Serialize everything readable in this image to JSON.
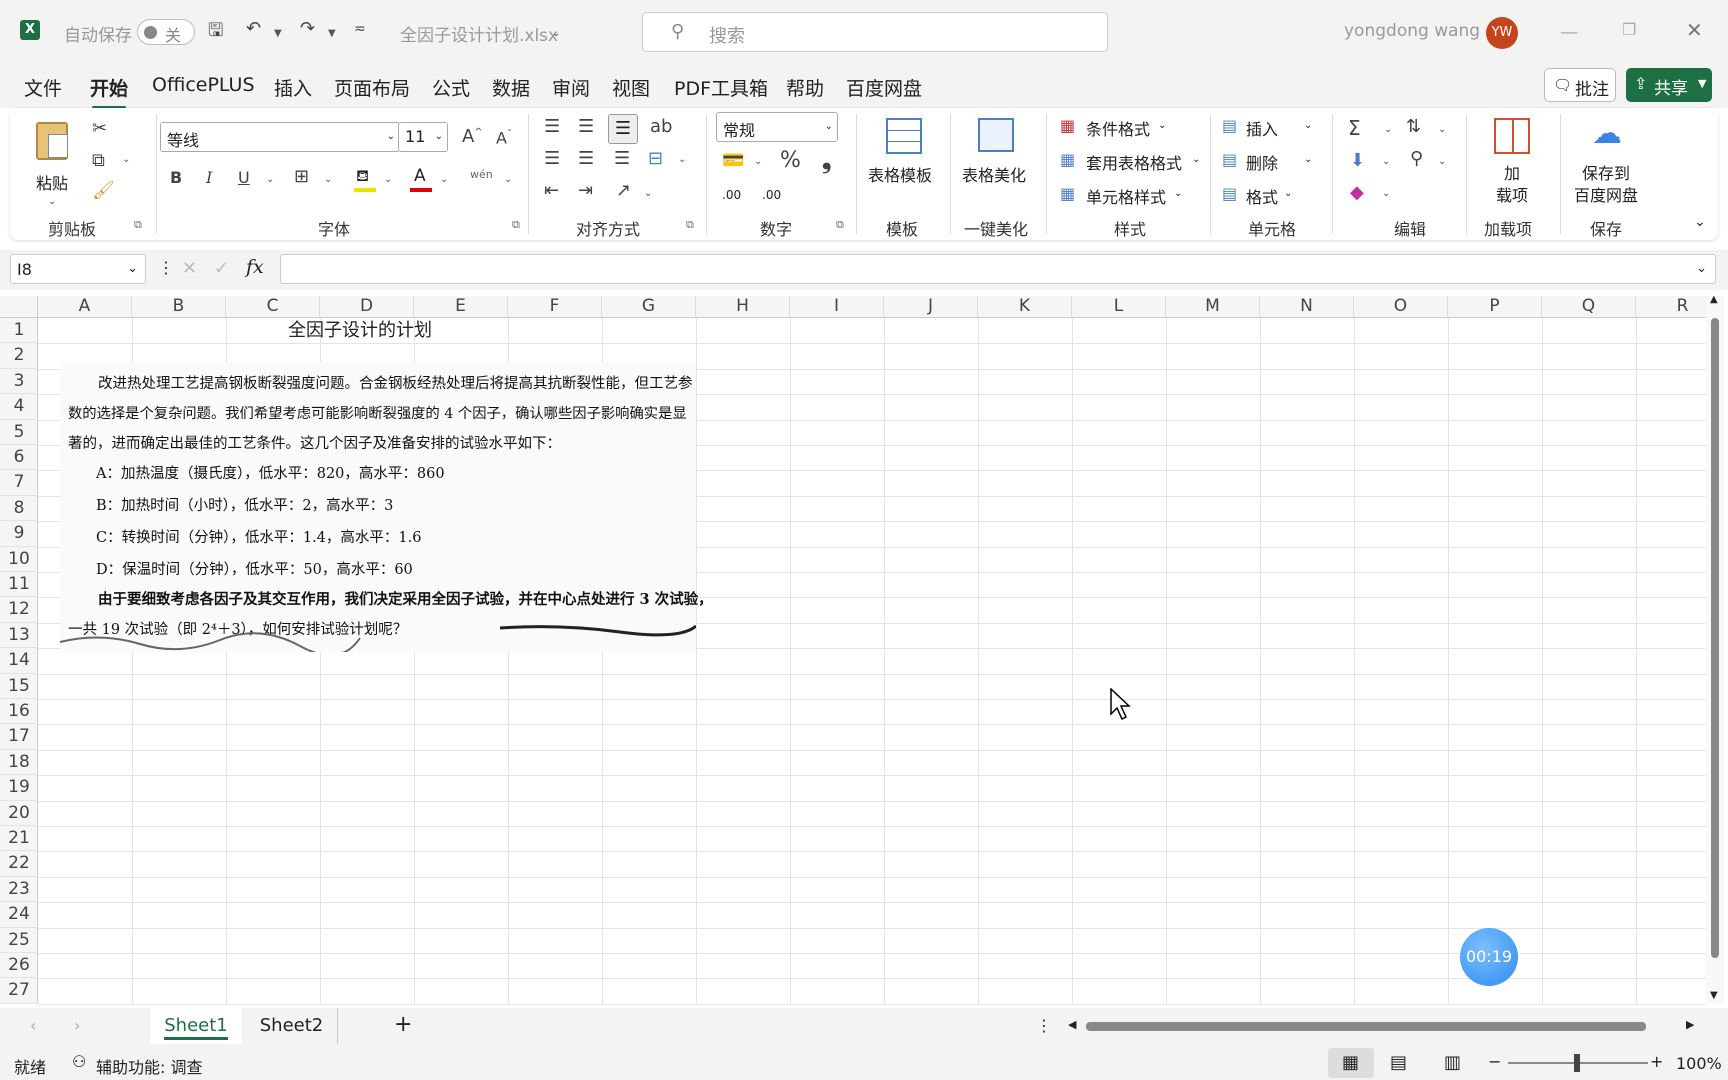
{
  "titlebar": {
    "autosave_label": "自动保存",
    "autosave_state": "关",
    "filename": "全因子设计计划.xlsx",
    "search_placeholder": "搜索",
    "user_name": "yongdong wang",
    "user_initials": "YW",
    "brand_color": "#1d7044",
    "avatar_color": "#c4451c"
  },
  "menu": {
    "items": [
      "文件",
      "开始",
      "OfficePLUS",
      "插入",
      "页面布局",
      "公式",
      "数据",
      "审阅",
      "视图",
      "PDF工具箱",
      "帮助",
      "百度网盘"
    ],
    "active": "开始",
    "comment_label": "批注",
    "share_label": "共享"
  },
  "ribbon": {
    "clipboard": {
      "paste": "粘贴",
      "group": "剪贴板"
    },
    "font": {
      "name": "等线",
      "size": "11",
      "group": "字体",
      "bold": "B",
      "italic": "I",
      "underline": "U",
      "phonetic": "wén"
    },
    "alignment": {
      "group": "对齐方式"
    },
    "number": {
      "format": "常规",
      "group": "数字",
      "percent": "%",
      "comma": "❟",
      "inc_decimal": ".00",
      "dec_decimal": ".00"
    },
    "template": {
      "button": "表格模板",
      "group": "模板"
    },
    "beautify": {
      "button": "表格美化",
      "group": "一键美化"
    },
    "styles": {
      "conditional": "条件格式",
      "table_format": "套用表格格式",
      "cell_style": "单元格样式",
      "group": "样式"
    },
    "cells": {
      "insert": "插入",
      "delete": "删除",
      "format": "格式",
      "group": "单元格"
    },
    "editing": {
      "group": "编辑"
    },
    "addins": {
      "button_line1": "加",
      "button_line2": "载项",
      "group": "加载项"
    },
    "save": {
      "button_line1": "保存到",
      "button_line2": "百度网盘",
      "group": "保存"
    }
  },
  "formula_bar": {
    "name_box": "I8",
    "fx": "fx",
    "content": ""
  },
  "grid": {
    "columns": [
      "A",
      "B",
      "C",
      "D",
      "E",
      "F",
      "G",
      "H",
      "I",
      "J",
      "K",
      "L",
      "M",
      "N",
      "O",
      "P",
      "Q",
      "R"
    ],
    "rows": [
      "1",
      "2",
      "3",
      "4",
      "5",
      "6",
      "7",
      "8",
      "9",
      "10",
      "11",
      "12",
      "13",
      "14",
      "15",
      "16",
      "17",
      "18",
      "19",
      "20",
      "21",
      "22",
      "23",
      "24",
      "25",
      "26",
      "27"
    ],
    "title_cell": "全因子设计的计划",
    "image_text": [
      "改进热处理工艺提高钢板断裂强度问题。合金钢板经热处理后将提高其抗断裂性能，但工艺参",
      "数的选择是个复杂问题。我们希望考虑可能影响断裂强度的 4 个因子，确认哪些因子影响确实是显",
      "著的，进而确定出最佳的工艺条件。这几个因子及准备安排的试验水平如下：",
      "A：加热温度（摄氏度），低水平：820，高水平：860",
      "B：加热时间（小时），低水平：2，高水平：3",
      "C：转换时间（分钟），低水平：1.4，高水平：1.6",
      "D：保温时间（分钟），低水平：50，高水平：60",
      "由于要细致考虑各因子及其交互作用，我们决定采用全因子试验，并在中心点处进行 3 次试验，",
      "一共 19 次试验（即 2⁴＋3），如何安排试验计划呢？"
    ]
  },
  "recording_timer": "00:19",
  "sheets": {
    "tabs": [
      "Sheet1",
      "Sheet2"
    ],
    "active": "Sheet1",
    "add": "+"
  },
  "status": {
    "ready": "就绪",
    "accessibility": "辅助功能: 调查",
    "zoom": "100%"
  }
}
